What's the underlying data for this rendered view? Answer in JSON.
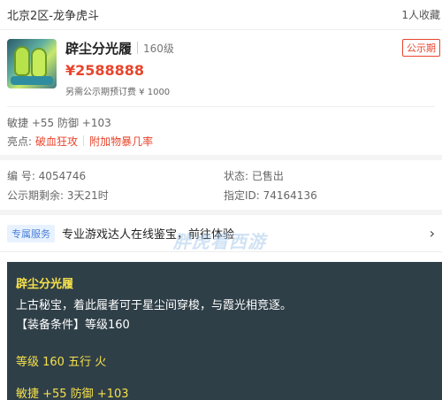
{
  "header": {
    "server": "北京2区-龙争虎斗",
    "favorites": "1人收藏"
  },
  "item": {
    "name": "辟尘分光履",
    "level": "160级",
    "price": "¥2588888",
    "fee": "另需公示期预订费 ¥ 1000",
    "public_badge": "公示期"
  },
  "attrs": {
    "stats": "敏捷 +55 防御 +103",
    "highlight_label": "亮点:",
    "highlights": [
      "破血狂攻",
      "附加物暴几率"
    ]
  },
  "meta": {
    "id": "编 号:  4054746",
    "status": "状态:  已售出",
    "remaining": "公示期剩余:  3天21时",
    "designated": "指定ID:  74164136"
  },
  "service": {
    "tag": "专属服务",
    "text": "专业游戏达人在线鉴宝，前往体验",
    "arrow": "›"
  },
  "watermark": "胖虎看西游",
  "detail": {
    "name": "辟尘分光履",
    "desc": "上古秘宝，着此履者可于星尘间穿梭，与霞光相竞逐。",
    "requirement": "【装备条件】等级160",
    "level_line": "等级 160 五行 火",
    "cut_line": "敏捷 +55 防御 +103"
  }
}
